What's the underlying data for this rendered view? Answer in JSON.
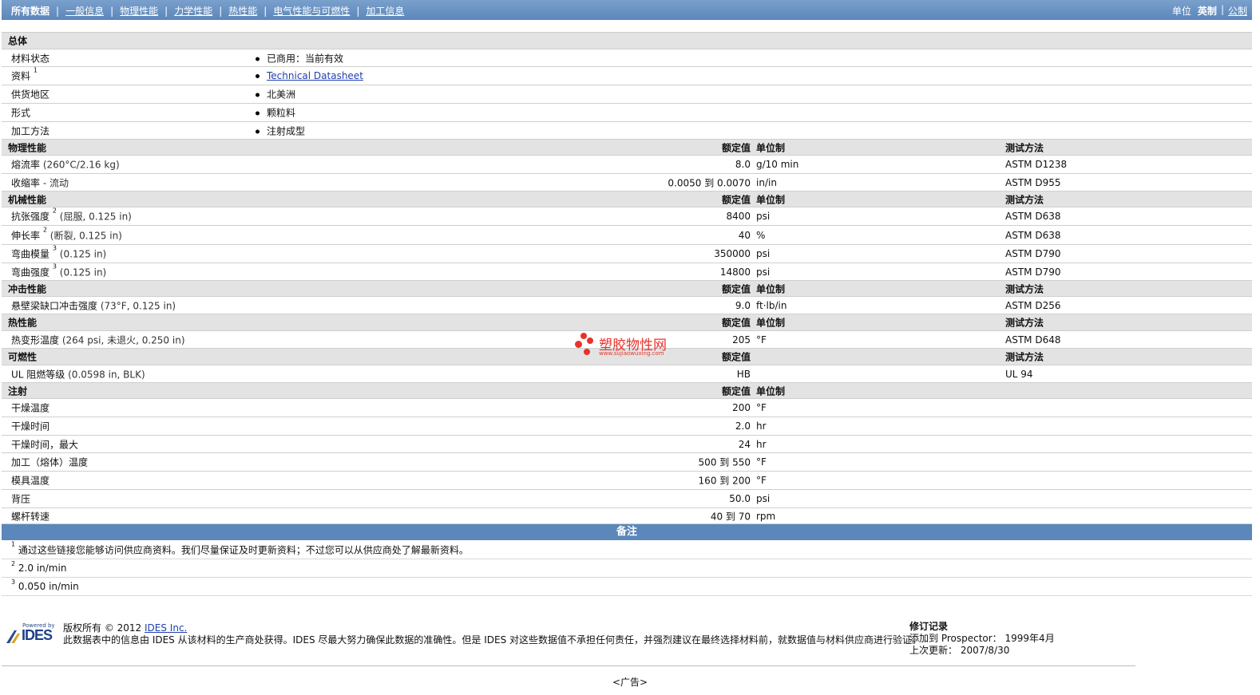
{
  "nav": {
    "items": [
      "所有数据",
      "一般信息",
      "物理性能",
      "力学性能",
      "热性能",
      "电气性能与可燃性",
      "加工信息"
    ],
    "unit_label": "单位",
    "unit_english": "英制",
    "unit_metric": "公制"
  },
  "general": {
    "title": "总体",
    "rows": [
      {
        "label": "材料状态",
        "value": "已商用：当前有效"
      },
      {
        "label": "资料",
        "sup": "1",
        "value": "Technical Datasheet"
      },
      {
        "label": "供货地区",
        "value": "北美洲"
      },
      {
        "label": "形式",
        "value": "颗粒料"
      },
      {
        "label": "加工方法",
        "value": "注射成型"
      }
    ]
  },
  "col_headers": {
    "value": "额定值",
    "unit": "单位制",
    "test": "测试方法"
  },
  "physical": {
    "title": "物理性能",
    "rows": [
      {
        "label": "熔流率",
        "cond": "(260°C/2.16 kg)",
        "value": "8.0",
        "unit": "g/10 min",
        "test": "ASTM D1238"
      },
      {
        "label": "收缩率",
        "cond": "- 流动",
        "value": "0.0050 到  0.0070",
        "unit": "in/in",
        "test": "ASTM D955"
      }
    ]
  },
  "mechanical": {
    "title": "机械性能",
    "rows": [
      {
        "label": "抗张强度",
        "sup": "2",
        "cond": "(屈服, 0.125 in)",
        "value": "8400",
        "unit": "psi",
        "test": "ASTM D638"
      },
      {
        "label": "伸长率",
        "sup": "2",
        "cond": "(断裂, 0.125 in)",
        "value": "40",
        "unit": "%",
        "test": "ASTM D638"
      },
      {
        "label": "弯曲模量",
        "sup": "3",
        "cond": "(0.125 in)",
        "value": "350000",
        "unit": "psi",
        "test": "ASTM D790"
      },
      {
        "label": "弯曲强度",
        "sup": "3",
        "cond": "(0.125 in)",
        "value": "14800",
        "unit": "psi",
        "test": "ASTM D790"
      }
    ]
  },
  "impact": {
    "title": "冲击性能",
    "rows": [
      {
        "label": "悬壁梁缺口冲击强度",
        "cond": "(73°F, 0.125 in)",
        "value": "9.0",
        "unit": "ft·lb/in",
        "test": "ASTM D256"
      }
    ]
  },
  "thermal": {
    "title": "热性能",
    "rows": [
      {
        "label": "热变形温度",
        "cond": "(264 psi, 未退火, 0.250 in)",
        "value": "205",
        "unit": "°F",
        "test": "ASTM D648"
      }
    ]
  },
  "flammability": {
    "title": "可燃性",
    "rows": [
      {
        "label": "UL 阻燃等级",
        "cond": "(0.0598 in, BLK)",
        "value": "HB",
        "unit": "",
        "test": "UL 94"
      }
    ]
  },
  "injection": {
    "title": "注射",
    "rows": [
      {
        "label": "干燥温度",
        "value": "200",
        "unit": "°F"
      },
      {
        "label": "干燥时间",
        "value": "2.0",
        "unit": "hr"
      },
      {
        "label": "干燥时间，最大",
        "value": "24",
        "unit": "hr"
      },
      {
        "label": "加工（熔体）温度",
        "value": "500 到  550",
        "unit": "°F"
      },
      {
        "label": "模具温度",
        "value": "160 到  200",
        "unit": "°F"
      },
      {
        "label": "背压",
        "value": "50.0",
        "unit": "psi"
      },
      {
        "label": "螺杆转速",
        "value": "40 到  70",
        "unit": "rpm"
      }
    ]
  },
  "notes": {
    "title": "备注",
    "items": [
      {
        "num": "1",
        "text": "通过这些链接您能够访问供应商资料。我们尽量保证及时更新资料；不过您可以从供应商处了解最新资料。"
      },
      {
        "num": "2",
        "text": "2.0 in/min"
      },
      {
        "num": "3",
        "text": "0.050 in/min"
      }
    ]
  },
  "footer": {
    "logo_top": "Powered by",
    "logo_text": "IDES",
    "copyright_prefix": "版权所有  © 2012",
    "copyright_link": "IDES Inc.",
    "disclaimer": "此数据表中的信息由  IDES 从该材料的生产商处获得。IDES 尽最大努力确保此数据的准确性。但是  IDES 对这些数据值不承担任何责任，并强烈建议在最终选择材料前，就数据值与材料供应商进行验证。",
    "revision_title": "修订记录",
    "added_label": "添加到  Prospector：",
    "added_value": "1999年4月",
    "updated_label": "上次更新：",
    "updated_value": "2007/8/30",
    "ad": "<广告>"
  },
  "watermark": {
    "text": "塑胶物性网",
    "sub": "www.sujiaowuxing.com"
  },
  "colors": {
    "header_blue": "#5b87bb",
    "section_gray": "#e3e3e3",
    "link": "#1f3fb0",
    "watermark_red": "#e8332a"
  }
}
